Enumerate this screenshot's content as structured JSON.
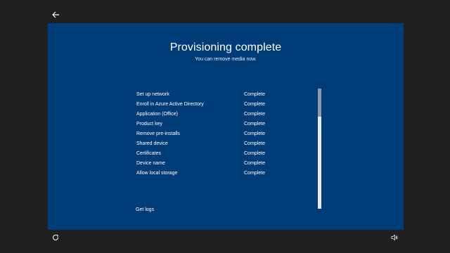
{
  "header": {
    "title": "Provisioning complete",
    "subtitle": "You can remove media now."
  },
  "items": [
    {
      "label": "Set up network",
      "status": "Complete"
    },
    {
      "label": "Enroll in Azure Active Directory",
      "status": "Complete"
    },
    {
      "label": "Application (Office)",
      "status": "Complete"
    },
    {
      "label": "Product key",
      "status": "Complete"
    },
    {
      "label": "Remove pre-installs",
      "status": "Complete"
    },
    {
      "label": "Shared device",
      "status": "Complete"
    },
    {
      "label": "Certificates",
      "status": "Complete"
    },
    {
      "label": "Device name",
      "status": "Complete"
    },
    {
      "label": "Allow local storage",
      "status": "Complete"
    }
  ],
  "footer": {
    "get_logs_label": "Get logs"
  },
  "icons": {
    "back": "back-arrow-icon",
    "ease_of_access": "ease-of-access-icon",
    "volume": "volume-icon"
  },
  "colors": {
    "background": "#1f1f1f",
    "panel": "#003c78",
    "text": "#ffffff"
  }
}
